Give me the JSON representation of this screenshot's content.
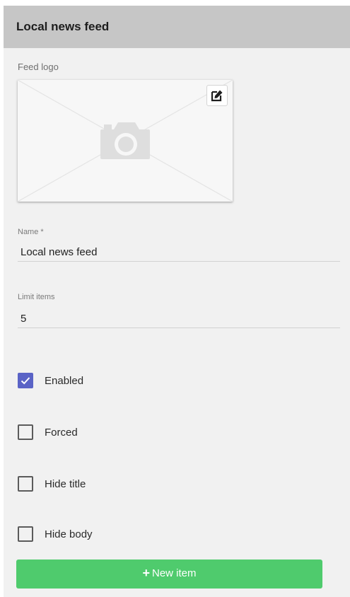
{
  "header": {
    "title": "Local news feed"
  },
  "logo": {
    "label": "Feed logo",
    "placeholder_icon": "camera-icon",
    "edit_icon": "edit-icon"
  },
  "fields": {
    "name": {
      "label": "Name *",
      "value": "Local news feed"
    },
    "limit": {
      "label": "Limit items",
      "value": "5"
    }
  },
  "checkboxes": [
    {
      "label": "Enabled",
      "checked": true
    },
    {
      "label": "Forced",
      "checked": false
    },
    {
      "label": "Hide title",
      "checked": false
    },
    {
      "label": "Hide body",
      "checked": false
    }
  ],
  "new_item_button": {
    "label": "New item",
    "icon": "plus-icon"
  },
  "colors": {
    "header_bg": "#c6c6c6",
    "panel_bg": "#f1f1f1",
    "checkbox_checked": "#5a63c6",
    "button_green": "#4fcb6d"
  }
}
